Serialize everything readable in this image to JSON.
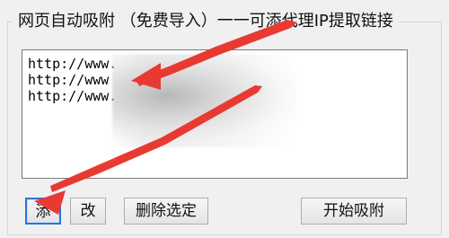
{
  "window": {
    "group_title": "网页自动吸附 （免费导入）一一可添代理IP提取链接"
  },
  "listbox": {
    "items": [
      "http://www.",
      "http://www",
      "http://www."
    ]
  },
  "buttons": {
    "add": "添",
    "edit": "改",
    "delete": "删除选定",
    "start": "开始吸附"
  },
  "colors": {
    "background": "#f0f0f0",
    "focus_border": "#2b76d1",
    "arrow": "#e83a32"
  },
  "icons": {
    "arrow_to_list": "arrow-right-icon",
    "arrow_to_add": "arrow-left-icon"
  }
}
